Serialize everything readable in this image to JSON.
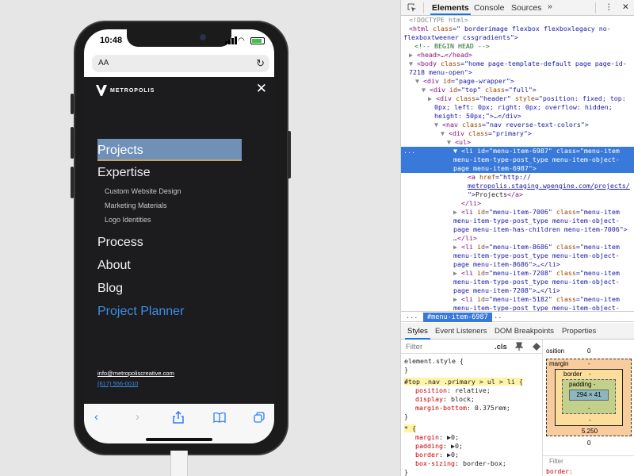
{
  "phone": {
    "time": "10:48",
    "url_bar": {
      "aa": "AA",
      "reload_icon": "reload-icon"
    },
    "site": {
      "logo_text": "METROPOLIS",
      "close_label": "✕",
      "menu": [
        {
          "label": "Projects",
          "state": "selected"
        },
        {
          "label": "Expertise",
          "children": [
            "Custom Website Design",
            "Marketing Materials",
            "Logo Identities"
          ]
        },
        {
          "label": "Process"
        },
        {
          "label": "About"
        },
        {
          "label": "Blog"
        },
        {
          "label": "Project Planner",
          "state": "accent"
        }
      ],
      "email": "info@metropoliscreative.com",
      "phone_number": "(617) 556-0010"
    },
    "toolbar": [
      "back-icon",
      "forward-icon",
      "share-icon",
      "bookmarks-icon",
      "tabs-icon"
    ]
  },
  "devtools": {
    "tabs": [
      "Elements",
      "Console",
      "Sources"
    ],
    "active_tab": "Elements",
    "more": "»",
    "menu_dots": "⋮",
    "close": "✕",
    "dom": {
      "l1": "<!DOCTYPE html>",
      "l2a": "<html ",
      "l2b": "class",
      "l2c": "=\"",
      "l2d": " borderimage flexbox flexboxlegacy no-",
      "l3": "flexboxtweener cssgradients\">",
      "l4": "<!-- BEGIN HEAD -->",
      "l5": "<head>…</head>",
      "l6a": "<body ",
      "l6b": "class",
      "l6c": "=\"home page-template-default page page-id-",
      "l7": "7218 menu-open\">",
      "l8a": "<div ",
      "l8b": "id",
      "l8c": "=\"page-wrapper\">",
      "l9a": "<div ",
      "l9b": "id",
      "l9c": "=\"top\" ",
      "l9d": "class",
      "l9e": "=\"full\">",
      "l10a": "<div ",
      "l10b": "class",
      "l10c": "=\"header\" ",
      "l10d": "style",
      "l10e": "=\"position: fixed; top:",
      "l11": "0px; left: 0px; right: 0px; overflow: hidden;",
      "l12": "height: 50px;\">…</div>",
      "l13a": "<nav ",
      "l13b": "class",
      "l13c": "=\"nav reverse-text-colors\">",
      "l14a": "<div ",
      "l14b": "class",
      "l14c": "=\"primary\">",
      "l15": "<ul>",
      "l16dots": "...",
      "l16a": "<li ",
      "l16b": "id",
      "l16c": "=\"menu-item-6987\" ",
      "l16d": "class",
      "l16e": "=\"menu-item",
      "l17": "menu-item-type-post_type menu-item-object-",
      "l18": "page menu-item-6987\">",
      "l19a": "<a ",
      "l19b": "href",
      "l19c": "=\"http://",
      "l20": "metropolis.staging.wpengine.com/projects/",
      "l21a": "\">",
      "l21b": "Projects",
      "l21c": "</a>",
      "l22": "</li>",
      "l23a": "<li ",
      "l23b": "id",
      "l23c": "=\"menu-item-7006\" ",
      "l23d": "class",
      "l23e": "=\"menu-item",
      "l24": "menu-item-type-post_type menu-item-object-",
      "l25": "page menu-item-has-children menu-item-7006\">",
      "l26": "…</li>",
      "l27a": "<li ",
      "l27b": "id",
      "l27c": "=\"menu-item-8686\" ",
      "l27d": "class",
      "l27e": "=\"menu-item",
      "l28": "menu-item-type-post_type menu-item-object-",
      "l29": "page menu-item-8686\">…</li>",
      "l30a": "<li ",
      "l30b": "id",
      "l30c": "=\"menu-item-7208\" ",
      "l30d": "class",
      "l30e": "=\"menu-item",
      "l31": "menu-item-type-post_type menu-item-object-",
      "l32": "page menu-item-7208\">…</li>",
      "l33a": "<li ",
      "l33b": "id",
      "l33c": "=\"menu-item-5182\" ",
      "l33d": "class",
      "l33e": "=\"menu-item",
      "l34": "menu-item-type-post_type menu-item-object-",
      "l35": "page menu-item-5182\">…</li>",
      "l36": "<li id=\"menu-item-6991\" class=\"color-menu"
    },
    "breadcrumb": {
      "dots": "...",
      "current": "#menu-item-6987",
      "more": "..."
    },
    "subtabs": [
      "Styles",
      "Event Listeners",
      "DOM Breakpoints",
      "Properties"
    ],
    "styles": {
      "filter_placeholder": "Filter",
      "cls": ".cls",
      "pin_icon": "pin-icon",
      "paint_icon": "paint-icon",
      "r1": "element.style {",
      "r2": "}",
      "r3": "#top .nav .primary > ul > li {",
      "r4p": "position",
      "r4v": ": relative;",
      "r5p": "display",
      "r5v": ": block;",
      "r6p": "margin-bottom",
      "r6v": ": 0.375rem;",
      "r7": "}",
      "r8": "* {",
      "r9p": "margin",
      "r9v": ": ▶0;",
      "r10p": "padding",
      "r10v": ": ▶0;",
      "r11p": "border",
      "r11v": ": ▶0;",
      "r12p": "box-sizing",
      "r12v": ": border-box;",
      "r13": "}"
    },
    "boxmodel": {
      "position_label": "osition",
      "position_value": "0",
      "margin_label": "margin",
      "margin_top": "-",
      "border_label": "border",
      "border_top": "-",
      "padding_label": "padding -",
      "content": "294 × 41",
      "padding_bottom": "-",
      "border_bottom": "-",
      "margin_bottom": "5.250",
      "position_bottom": "0",
      "filter": "Filter",
      "next_rule": "border:"
    }
  }
}
